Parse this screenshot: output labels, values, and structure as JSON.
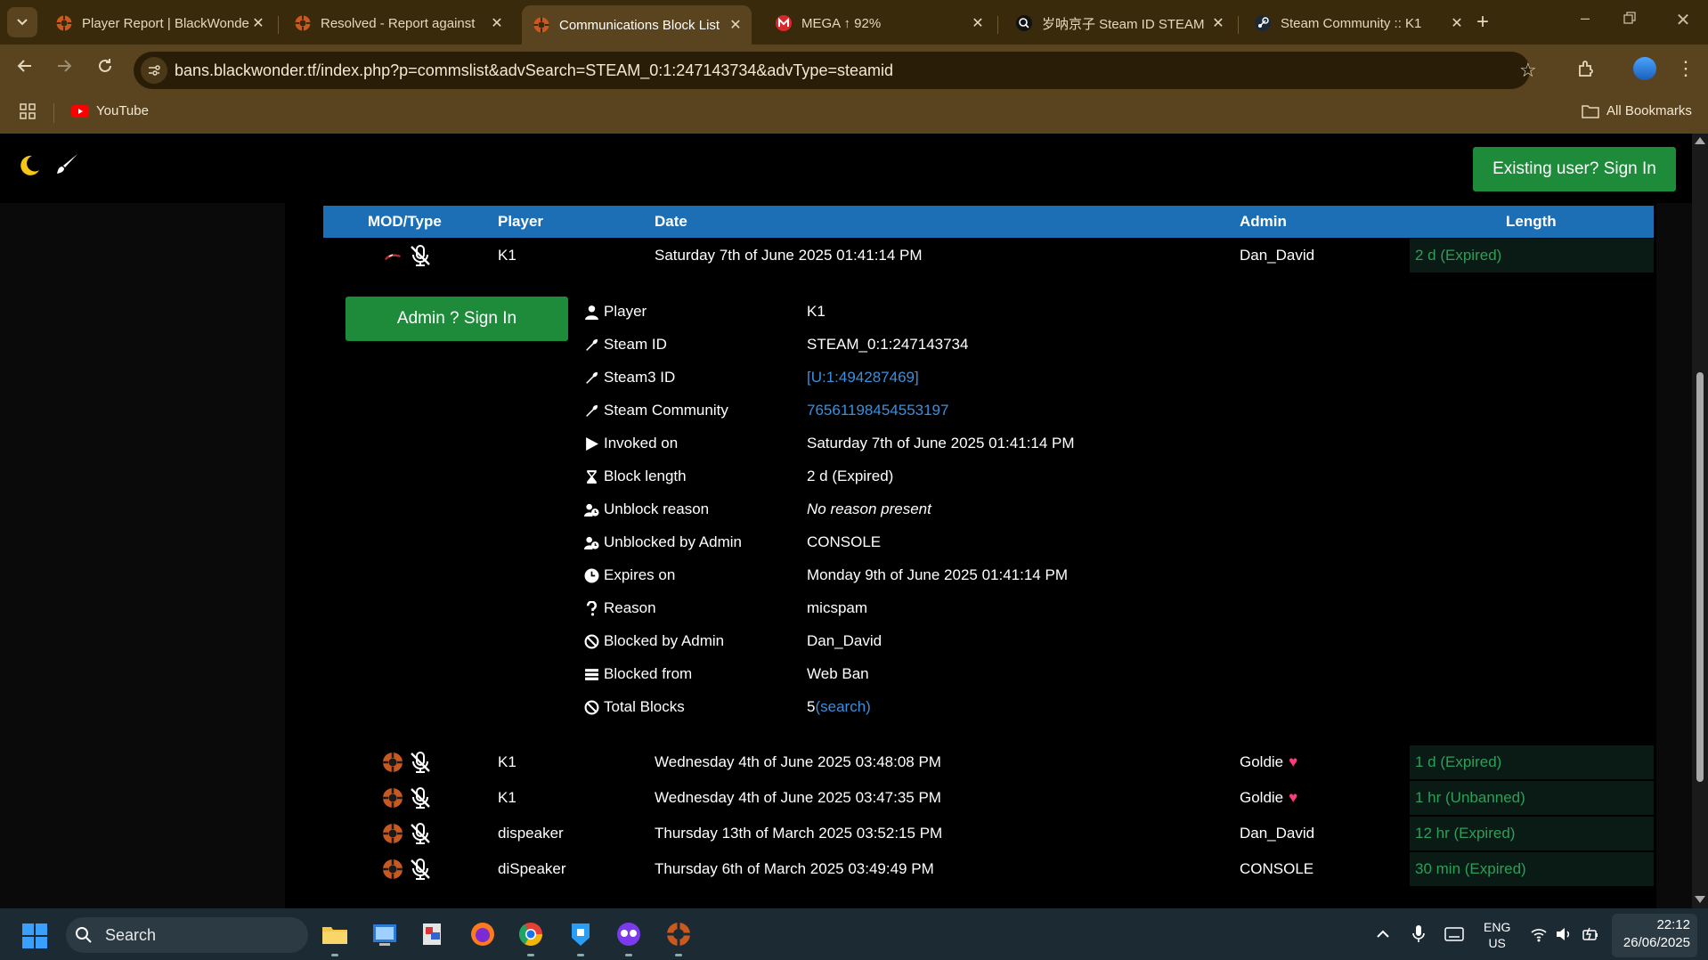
{
  "browser": {
    "tabs": [
      {
        "title": "Player Report | BlackWonder",
        "icon": "tf2-icon",
        "active": false
      },
      {
        "title": "Resolved - Report against",
        "icon": "tf2-icon",
        "active": false
      },
      {
        "title": "Communications Block List",
        "icon": "tf2-icon",
        "active": true
      },
      {
        "title": "MEGA ↑ 92%",
        "icon": "mega-icon",
        "active": false
      },
      {
        "title": "岁呐京子 Steam ID STEAM",
        "icon": "steamid-icon",
        "active": false
      },
      {
        "title": "Steam Community :: K1",
        "icon": "steam-icon",
        "active": false
      }
    ],
    "new_tab": "+",
    "url": "bans.blackwonder.tf/index.php?p=commslist&advSearch=STEAM_0:1:247143734&advType=steamid",
    "bookmarks": [
      {
        "label": "YouTube",
        "icon": "youtube-icon"
      }
    ],
    "all_bookmarks": "All Bookmarks"
  },
  "page": {
    "signin_top": "Existing user? Sign In",
    "table_headers": {
      "mod_type": "MOD/Type",
      "player": "Player",
      "date": "Date",
      "admin": "Admin",
      "length": "Length"
    },
    "rows": [
      {
        "player": "K1",
        "date": "Saturday 7th of June 2025 01:41:14 PM",
        "admin": "Dan_David",
        "admin_heart": false,
        "length": "2 d (Expired)"
      },
      {
        "player": "K1",
        "date": "Wednesday 4th of June 2025 03:48:08 PM",
        "admin": "Goldie",
        "admin_heart": true,
        "length": "1 d (Expired)"
      },
      {
        "player": "K1",
        "date": "Wednesday 4th of June 2025 03:47:35 PM",
        "admin": "Goldie",
        "admin_heart": true,
        "length": "1 hr (Unbanned)"
      },
      {
        "player": "dispeaker",
        "date": "Thursday 13th of March 2025 03:52:15 PM",
        "admin": "Dan_David",
        "admin_heart": false,
        "length": "12 hr (Expired)"
      },
      {
        "player": "diSpeaker",
        "date": "Thursday 6th of March 2025 03:49:49 PM",
        "admin": "CONSOLE",
        "admin_heart": false,
        "length": "30 min (Expired)"
      }
    ],
    "admin_signin": "Admin ? Sign In",
    "details": [
      {
        "label": "Player",
        "icon": "user-icon",
        "value": "K1"
      },
      {
        "label": "Steam ID",
        "icon": "wrench-icon",
        "value": "STEAM_0:1:247143734"
      },
      {
        "label": "Steam3 ID",
        "icon": "wrench-icon",
        "value": "[U:1:494287469]",
        "link": true
      },
      {
        "label": "Steam Community",
        "icon": "wrench-icon",
        "value": "76561198454553197",
        "link": true
      },
      {
        "label": "Invoked on",
        "icon": "play-icon",
        "value": "Saturday 7th of June 2025 01:41:14 PM"
      },
      {
        "label": "Block length",
        "icon": "hourglass-icon",
        "value": "2 d (Expired)"
      },
      {
        "label": "Unblock reason",
        "icon": "user-clock-icon",
        "value": "No reason present",
        "italic": true
      },
      {
        "label": "Unblocked by Admin",
        "icon": "user-clock-icon",
        "value": "CONSOLE"
      },
      {
        "label": "Expires on",
        "icon": "clock-icon",
        "value": "Monday 9th of June 2025 01:41:14 PM"
      },
      {
        "label": "Reason",
        "icon": "question-icon",
        "value": "micspam"
      },
      {
        "label": "Blocked by Admin",
        "icon": "ban-icon",
        "value": "Dan_David"
      },
      {
        "label": "Blocked from",
        "icon": "server-icon",
        "value": "Web Ban"
      },
      {
        "label": "Total Blocks",
        "icon": "ban-icon",
        "value": "5",
        "link_text": "(search)"
      }
    ]
  },
  "taskbar": {
    "search": "Search",
    "lang1": "ENG",
    "lang2": "US",
    "time": "22:12",
    "date": "26/06/2025"
  },
  "colors": {
    "accent_blue": "#1c6fb4",
    "green_button": "#1e8b3a",
    "length_green": "#2f9e5a",
    "link": "#3a8fde"
  }
}
